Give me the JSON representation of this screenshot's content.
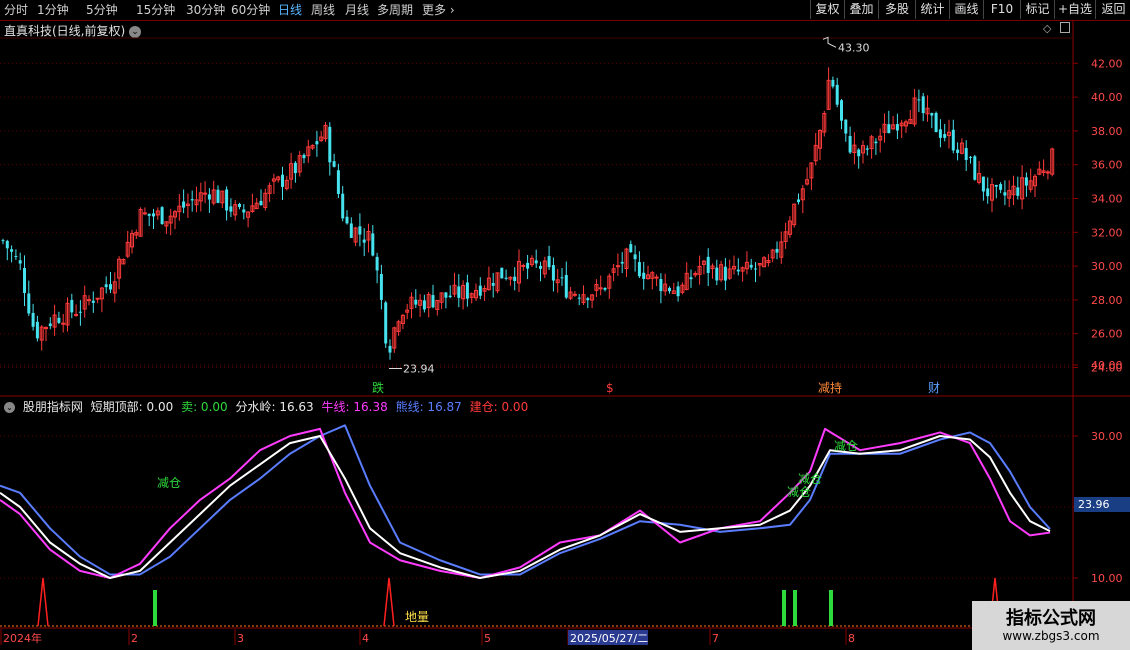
{
  "toolbar": {
    "timeframes": [
      "分时",
      "1分钟",
      "5分钟",
      "15分钟",
      "30分钟",
      "60分钟",
      "日线",
      "周线",
      "月线",
      "多周期",
      "更多"
    ],
    "active": "日线",
    "right_buttons": [
      "复权",
      "叠加",
      "多股",
      "统计",
      "画线",
      "F10",
      "标记",
      "+自选",
      "返回"
    ]
  },
  "stock": {
    "title": "直真科技(日线,前复权)"
  },
  "price_axis": {
    "ticks": [
      "42.00",
      "40.00",
      "38.00",
      "36.00",
      "34.00",
      "32.00",
      "30.00",
      "28.00",
      "26.00",
      "24.00"
    ]
  },
  "price_annotations": {
    "high": "43.30",
    "low": "23.94"
  },
  "event_markers": [
    {
      "text": "跌",
      "color": "#2ed93b"
    },
    {
      "text": "$",
      "color": "#ff3a3a"
    },
    {
      "text": "减持",
      "color": "#ff8a3a"
    },
    {
      "text": "财",
      "color": "#5aa0ff"
    }
  ],
  "indicator": {
    "name": "股朋指标网",
    "items": [
      {
        "label": "短期顶部: 0.00",
        "color": "#e8e8e8"
      },
      {
        "label": "卖: 0.00",
        "color": "#2ed93b"
      },
      {
        "label": "分水岭: 16.63",
        "color": "#e8e8e8"
      },
      {
        "label": "牛线: 16.38",
        "color": "#ff3cff"
      },
      {
        "label": "熊线: 16.87",
        "color": "#5a7dff"
      },
      {
        "label": "建仓: 0.00",
        "color": "#ff3a3a"
      }
    ],
    "axis_ticks": [
      "40.00",
      "30.00",
      "20.00",
      "10.00"
    ],
    "current_value": "23.96",
    "labels": [
      {
        "text": "减仓",
        "color": "#2ed93b"
      },
      {
        "text": "减仓",
        "color": "#2ed93b"
      },
      {
        "text": "减仓",
        "color": "#2ed93b"
      },
      {
        "text": "减仓",
        "color": "#2ed93b"
      },
      {
        "text": "地量",
        "color": "#ffe14a"
      }
    ]
  },
  "time_axis": {
    "labels": [
      "2024年",
      "2",
      "3",
      "4",
      "5",
      "2025/05/27/二",
      "7",
      "8"
    ]
  },
  "watermark": {
    "line1": "指标公式网",
    "line2": "www.zbgs3.com"
  },
  "colors": {
    "up": "#ff3a3a",
    "down": "#46e3ef",
    "bull": "#ff3cff",
    "bear": "#5a7dff",
    "water": "#ffffff",
    "sell": "#2ed93b",
    "build": "#ff2020",
    "grid": "#5a0000"
  }
}
